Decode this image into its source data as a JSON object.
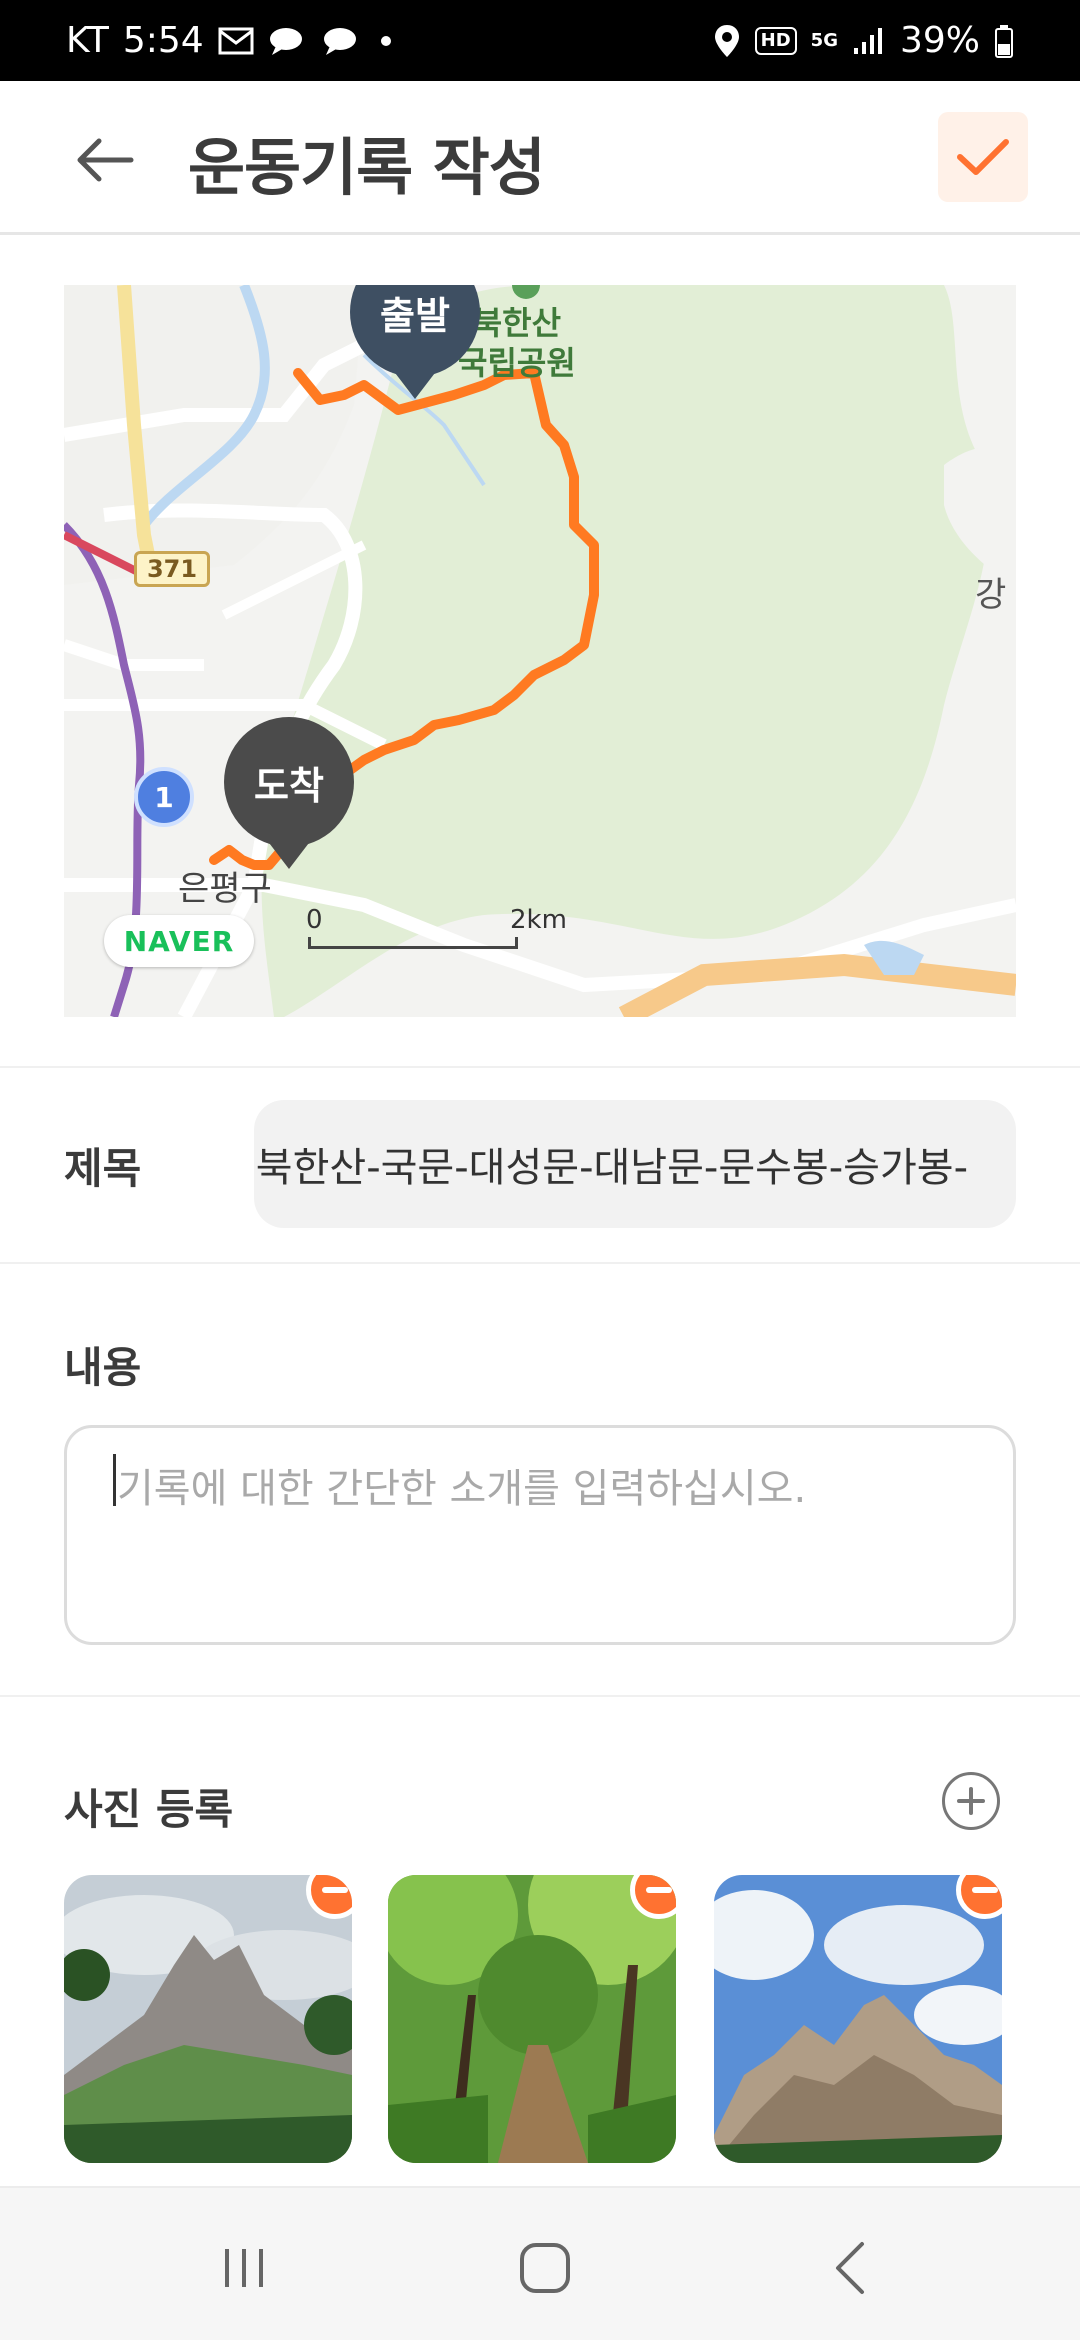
{
  "status_bar": {
    "carrier": "KT",
    "time": "5:54",
    "network": "5G",
    "hd": "HD",
    "battery": "39%",
    "icons": [
      "mail-icon",
      "chat-bubble-icon",
      "chat-bubble-icon",
      "dot-icon",
      "location-icon",
      "hd-voice-icon",
      "5g-icon",
      "signal-icon",
      "battery-icon"
    ]
  },
  "header": {
    "title": "운동기록 작성",
    "back_icon": "arrow-left-icon",
    "confirm_icon": "checkmark-icon",
    "accent_color": "#ff7231"
  },
  "map": {
    "start_label": "출발",
    "end_label": "도착",
    "park_label_line1": "북한산",
    "park_label_line2": "국립공원",
    "district_label": "은평구",
    "edge_label": "강",
    "road_371": "371",
    "road_1": "1",
    "provider": "NAVER",
    "scale_start": "0",
    "scale_end": "2km",
    "route_color": "#ff7a21"
  },
  "form": {
    "title_label": "제목",
    "title_value": "북한산-국문-대성문-대남문-문수봉-승가봉-",
    "content_label": "내용",
    "content_placeholder": "기록에 대한 간단한 소개를 입력하십시오.",
    "photos_label": "사진 등록",
    "photos": [
      {
        "subject": "mountain-peak-photo"
      },
      {
        "subject": "forest-trail-photo"
      },
      {
        "subject": "rock-cliff-photo"
      }
    ]
  },
  "nav_bar": {
    "icons": [
      "recent-apps-icon",
      "home-icon",
      "back-icon"
    ]
  }
}
